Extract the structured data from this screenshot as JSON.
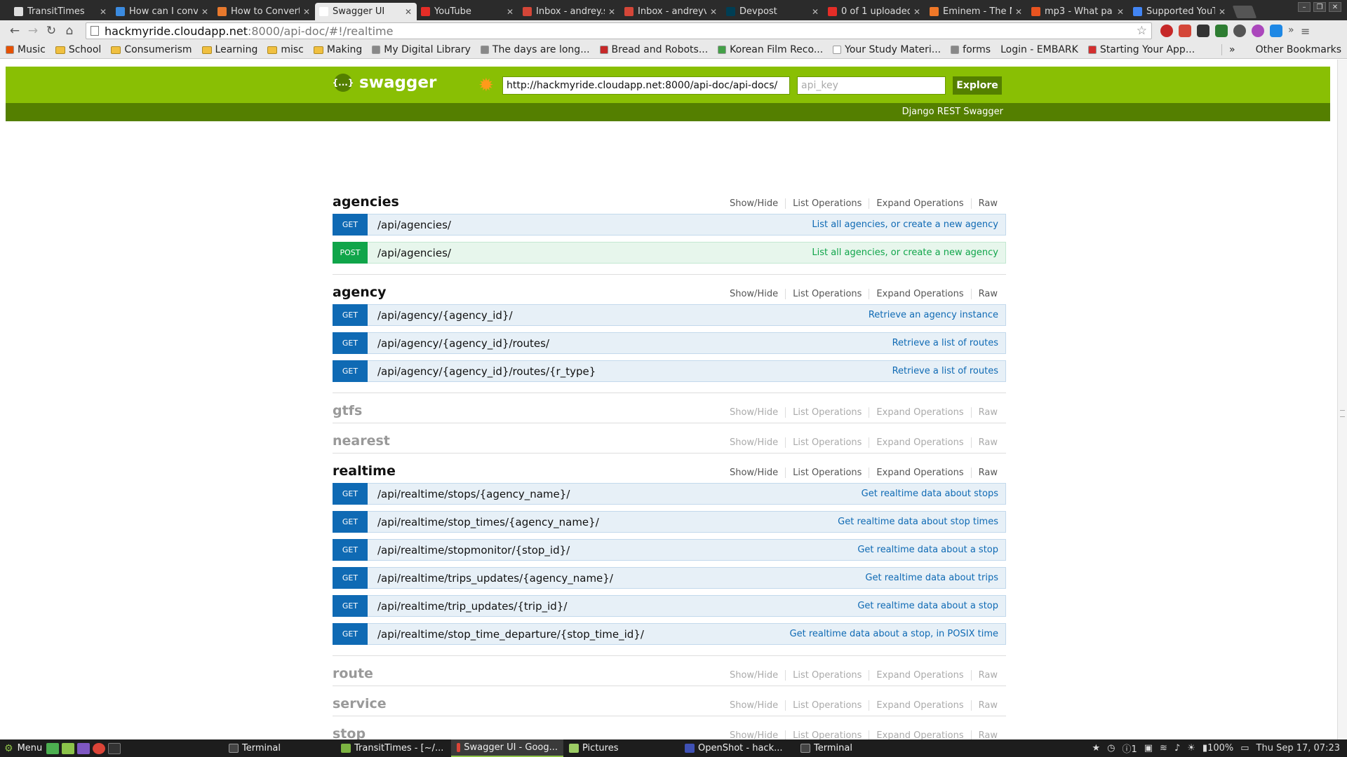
{
  "browser": {
    "tabs": [
      {
        "title": "TransitTimes",
        "icon": "page-icon",
        "color": "#dddddd",
        "active": false
      },
      {
        "title": "How can I conv",
        "icon": "stackoverflow-icon",
        "color": "#3b8be0",
        "active": false
      },
      {
        "title": "How to Convert",
        "icon": "firefox-icon",
        "color": "#e8792d",
        "active": false
      },
      {
        "title": "Swagger UI",
        "icon": "page-icon",
        "color": "#ffffff",
        "active": true
      },
      {
        "title": "YouTube",
        "icon": "youtube-icon",
        "color": "#e52d27",
        "active": false
      },
      {
        "title": "Inbox - andrey.s",
        "icon": "gmail-icon",
        "color": "#d44638",
        "active": false
      },
      {
        "title": "Inbox - andreyv",
        "icon": "gmail-icon",
        "color": "#d44638",
        "active": false
      },
      {
        "title": "Devpost",
        "icon": "devpost-icon",
        "color": "#003e54",
        "active": false
      },
      {
        "title": "0 of 1 uploaded",
        "icon": "youtube-icon",
        "color": "#e52d27",
        "active": false
      },
      {
        "title": "Eminem - The M",
        "icon": "music-icon",
        "color": "#f07828",
        "active": false
      },
      {
        "title": "mp3 - What pa",
        "icon": "askubuntu-icon",
        "color": "#e95420",
        "active": false
      },
      {
        "title": "Supported YouT",
        "icon": "google-icon",
        "color": "#4285f4",
        "active": false
      }
    ],
    "url_host": "hackmyride.cloudapp.net",
    "url_path": ":8000/api-doc/#!/realtime",
    "bookmarks": [
      {
        "label": "Music",
        "type": "music"
      },
      {
        "label": "School",
        "type": "folder"
      },
      {
        "label": "Consumerism",
        "type": "folder"
      },
      {
        "label": "Learning",
        "type": "folder"
      },
      {
        "label": "misc",
        "type": "folder"
      },
      {
        "label": "Making",
        "type": "folder"
      },
      {
        "label": "My Digital Library",
        "type": "page"
      },
      {
        "label": "The days are long...",
        "type": "page"
      },
      {
        "label": "Bread and Robots...",
        "type": "flag"
      },
      {
        "label": "Korean Film Reco...",
        "type": "dot"
      },
      {
        "label": "Your Study Materi...",
        "type": "doc"
      },
      {
        "label": "forms",
        "type": "page"
      },
      {
        "label": "Login - EMBARK",
        "type": "none"
      },
      {
        "label": "Starting Your App...",
        "type": "s"
      }
    ],
    "bookmarks_more": "»",
    "other_bookmarks": "Other Bookmarks"
  },
  "swagger": {
    "brand": "swagger",
    "brand_mark": "{...}",
    "url_value": "http://hackmyride.cloudapp.net:8000/api-doc/api-docs/",
    "api_key_placeholder": "api_key",
    "explore_label": "Explore",
    "subheader": "Django REST Swagger",
    "resource_actions": [
      "Show/Hide",
      "List Operations",
      "Expand Operations",
      "Raw"
    ],
    "resources": [
      {
        "name": "agencies",
        "expanded": true,
        "operations": [
          {
            "method": "GET",
            "path": "/api/agencies/",
            "summary": "List all agencies, or create a new agency"
          },
          {
            "method": "POST",
            "path": "/api/agencies/",
            "summary": "List all agencies, or create a new agency"
          }
        ]
      },
      {
        "name": "agency",
        "expanded": true,
        "operations": [
          {
            "method": "GET",
            "path": "/api/agency/{agency_id}/",
            "summary": "Retrieve an agency instance"
          },
          {
            "method": "GET",
            "path": "/api/agency/{agency_id}/routes/",
            "summary": "Retrieve a list of routes"
          },
          {
            "method": "GET",
            "path": "/api/agency/{agency_id}/routes/{r_type}",
            "summary": "Retrieve a list of routes"
          }
        ]
      },
      {
        "name": "gtfs",
        "expanded": false,
        "operations": []
      },
      {
        "name": "nearest",
        "expanded": false,
        "operations": []
      },
      {
        "name": "realtime",
        "expanded": true,
        "operations": [
          {
            "method": "GET",
            "path": "/api/realtime/stops/{agency_name}/",
            "summary": "Get realtime data about stops"
          },
          {
            "method": "GET",
            "path": "/api/realtime/stop_times/{agency_name}/",
            "summary": "Get realtime data about stop times"
          },
          {
            "method": "GET",
            "path": "/api/realtime/stopmonitor/{stop_id}/",
            "summary": "Get realtime data about a stop"
          },
          {
            "method": "GET",
            "path": "/api/realtime/trips_updates/{agency_name}/",
            "summary": "Get realtime data about trips"
          },
          {
            "method": "GET",
            "path": "/api/realtime/trip_updates/{trip_id}/",
            "summary": "Get realtime data about a stop"
          },
          {
            "method": "GET",
            "path": "/api/realtime/stop_time_departure/{stop_time_id}/",
            "summary": "Get realtime data about a stop, in POSIX time"
          }
        ]
      },
      {
        "name": "route",
        "expanded": false,
        "operations": []
      },
      {
        "name": "service",
        "expanded": false,
        "operations": []
      },
      {
        "name": "stop",
        "expanded": false,
        "operations": []
      }
    ]
  },
  "taskbar": {
    "menu_label": "Menu",
    "windows": [
      {
        "label": "Terminal",
        "icon": "terminal-icon",
        "color": "#444444",
        "active": false
      },
      {
        "label": "TransitTimes - [~/...",
        "icon": "android-studio-icon",
        "color": "#7cb342",
        "active": false
      },
      {
        "label": "Swagger UI - Goog...",
        "icon": "chrome-icon",
        "color": "#db4437",
        "active": true
      },
      {
        "label": "Pictures",
        "icon": "folder-icon",
        "color": "#9ccc65",
        "active": false
      },
      {
        "label": "OpenShot - hack...",
        "icon": "openshot-icon",
        "color": "#3f51b5",
        "active": false
      },
      {
        "label": "Terminal",
        "icon": "terminal-icon",
        "color": "#444444",
        "active": false
      }
    ],
    "notification_count": "1",
    "battery": "100%",
    "clock": "Thu Sep 17, 07:23"
  },
  "colors": {
    "swagger_green": "#89bf04",
    "swagger_dark_green": "#547f00",
    "get_blue": "#0f6ab4",
    "post_green": "#10a54a"
  }
}
